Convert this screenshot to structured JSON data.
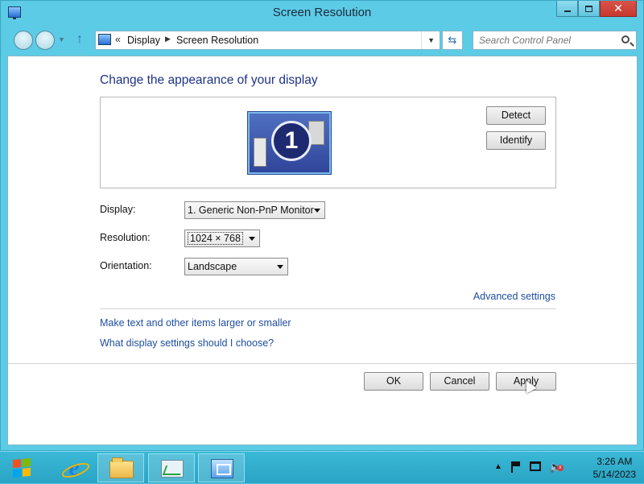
{
  "window": {
    "title": "Screen Resolution",
    "close_glyph": "✕"
  },
  "address_bar": {
    "chevrons": "«",
    "breadcrumb": [
      "Display",
      "Screen Resolution"
    ],
    "separator": "▶",
    "dropdown": "▼",
    "refresh": "⇆"
  },
  "search": {
    "placeholder": "Search Control Panel"
  },
  "main": {
    "heading": "Change the appearance of your display",
    "monitor_number": "1",
    "detect_label": "Detect",
    "identify_label": "Identify",
    "display_label": "Display:",
    "display_value": "1. Generic Non-PnP Monitor",
    "resolution_label": "Resolution:",
    "resolution_value": "1024 × 768",
    "orientation_label": "Orientation:",
    "orientation_value": "Landscape",
    "advanced_link": "Advanced settings",
    "link_larger": "Make text and other items larger or smaller",
    "link_choose": "What display settings should I choose?",
    "ok_label": "OK",
    "cancel_label": "Cancel",
    "apply_label": "Apply"
  },
  "taskbar": {
    "pinned": [
      "internet-explorer",
      "file-explorer",
      "performance-monitor",
      "control-panel"
    ],
    "active": "control-panel",
    "tray_up": "▲",
    "volume": "🔈",
    "volume_badge": "x",
    "time": "3:26 AM",
    "date": "5/14/2023"
  },
  "colors": {
    "frame": "#5ccbe6",
    "heading": "#1e3287",
    "link": "#1e4ea0",
    "taskbar": "#2aa4c4"
  }
}
